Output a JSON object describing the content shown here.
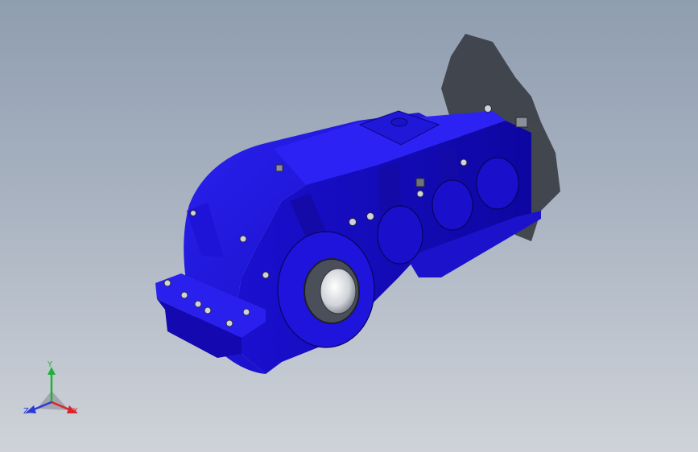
{
  "viewport": {
    "background_top": "#8f9db0",
    "background_bottom": "#cfd3d9"
  },
  "model": {
    "body_color": "#1a10d8",
    "shadow_color": "#3a3d44"
  },
  "triad": {
    "x_label": "X",
    "y_label": "Y",
    "z_label": "Z",
    "x_color": "#d8262a",
    "y_color": "#1fb23a",
    "z_color": "#2a3ad8"
  }
}
